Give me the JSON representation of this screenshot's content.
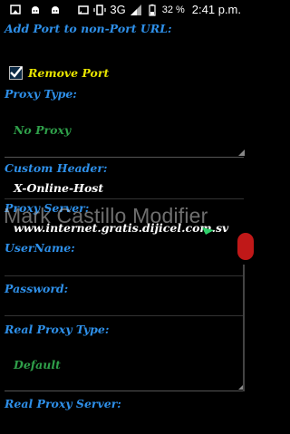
{
  "status_bar": {
    "icons": [
      "screenshot-icon",
      "android-debug-icon",
      "android-debug-icon-2",
      "cast-icon",
      "vibrate-icon"
    ],
    "network": "3G",
    "battery_percent": "32 %",
    "time": "2:41 p.m."
  },
  "form": {
    "add_port_label": "Add Port to non-Port URL:",
    "remove_port": {
      "label": "Remove Port",
      "checked": true
    },
    "proxy_type": {
      "label": "Proxy Type:",
      "value": "No Proxy"
    },
    "custom_header": {
      "label": "Custom Header:",
      "value": "X-Online-Host"
    },
    "proxy_server": {
      "label": "Proxy Server:",
      "value": "www.internet.gratis.dijicel.com.sv"
    },
    "username_label": "UserName:",
    "password_label": "Password:",
    "real_proxy_type": {
      "label": "Real Proxy Type:",
      "value": "Default"
    },
    "real_proxy_server_label": "Real Proxy Server:"
  },
  "watermark": "Mark Castillo Modifier",
  "colors": {
    "label_blue": "#2e8fe8",
    "value_green": "#2fa04a",
    "check_yellow": "#e8e400",
    "background": "#000000"
  }
}
